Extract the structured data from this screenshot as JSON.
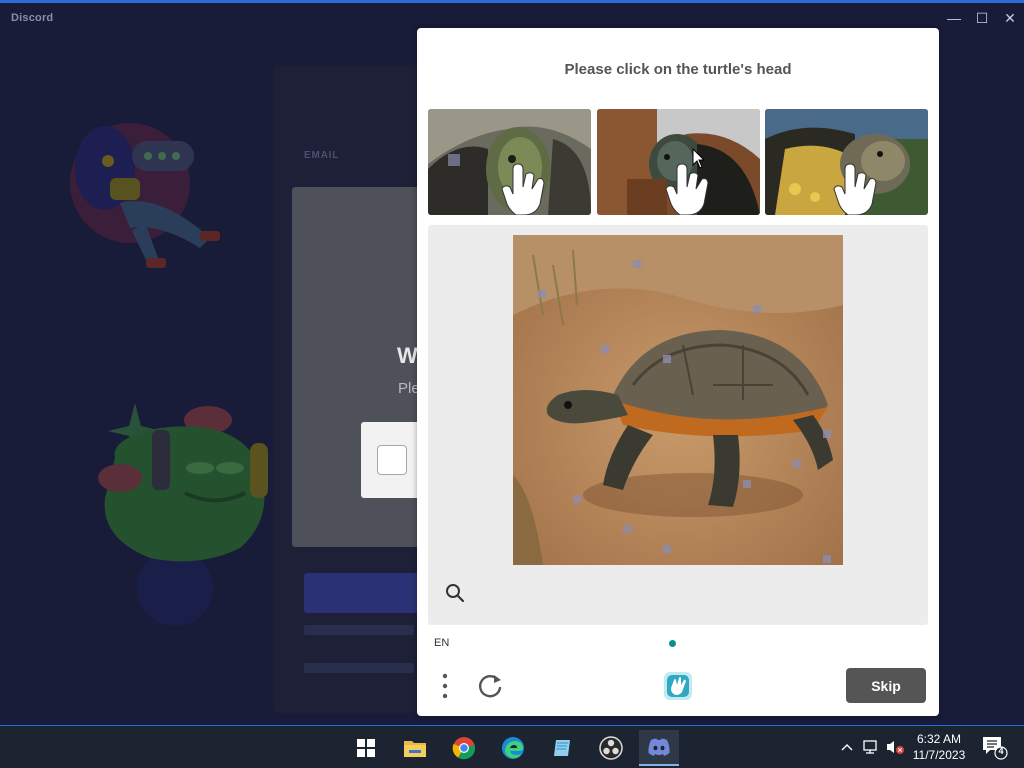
{
  "window": {
    "title": "Discord",
    "controls": {
      "minimize": "—",
      "maximize": "☐",
      "close": "✕"
    }
  },
  "background_login": {
    "email_label": "EMAIL",
    "heading_fragment": "W",
    "subtext_fragment": "Ple"
  },
  "captcha": {
    "prompt": "Please click on the turtle's head",
    "language": "EN",
    "skip_label": "Skip",
    "accent_color": "#0a8f8a"
  },
  "taskbar": {
    "icons": [
      "windows-start-icon",
      "file-explorer-icon",
      "chrome-icon",
      "edge-icon",
      "notepad-icon",
      "obs-icon",
      "discord-icon"
    ],
    "clock": {
      "time": "6:32 AM",
      "date": "11/7/2023"
    },
    "notification_count": "4"
  }
}
